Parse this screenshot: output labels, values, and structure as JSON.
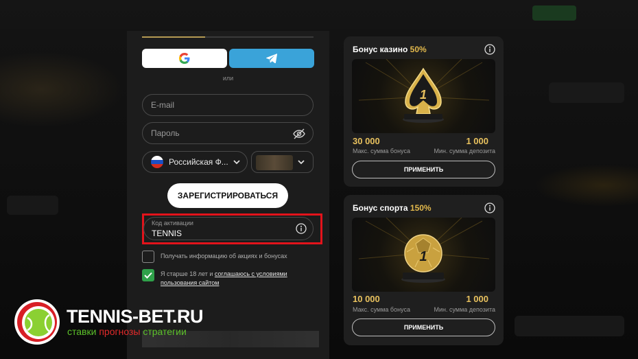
{
  "form": {
    "divider_text": "или",
    "email_placeholder": "E-mail",
    "password_placeholder": "Пароль",
    "country_label": "Российская Ф...",
    "register_label": "ЗАРЕГИСТРИРОВАТЬСЯ",
    "promo_label": "Код активации",
    "promo_value": "TENNIS",
    "newsletter_label": "Получать информацию об акциях и бонусах",
    "age_prefix": "Я старше 18 лет и ",
    "age_link": "соглашаюсь с условиями пользования сайтом",
    "newsletter_checked": false,
    "age_checked": true
  },
  "bonuses": [
    {
      "title": "Бонус казино ",
      "percent": "50%",
      "max_value": "30 000",
      "max_label": "Макс. сумма бонуса",
      "min_value": "1 000",
      "min_label": "Мин. сумма депозита",
      "button": "ПРИМЕНИТЬ",
      "image": "spade-trophy-icon"
    },
    {
      "title": "Бонус спорта ",
      "percent": "150%",
      "max_value": "10 000",
      "max_label": "Макс. сумма бонуса",
      "min_value": "1 000",
      "min_label": "Мин. сумма депозита",
      "button": "ПРИМЕНИТЬ",
      "image": "football-trophy-icon"
    }
  ],
  "watermark": {
    "brand": "TENNIS-BET.RU",
    "tag1": "ставки ",
    "tag2": "прогнозы ",
    "tag3": "стратегии"
  },
  "colors": {
    "accent_gold": "#e3b94c",
    "telegram_blue": "#3aa3d9",
    "highlight_red": "#e3131b",
    "check_green": "#2fa14a"
  }
}
